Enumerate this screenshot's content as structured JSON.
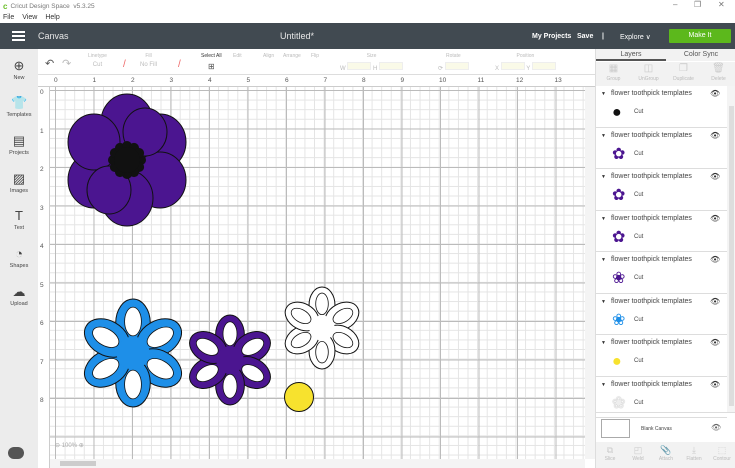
{
  "app": {
    "logo": "c",
    "title": "Cricut Design Space",
    "version": "v5.3.25"
  },
  "window": {
    "minimize": "–",
    "restore": "❐",
    "close": "✕"
  },
  "menu": [
    "File",
    "View",
    "Help"
  ],
  "header": {
    "section": "Canvas",
    "document": "Untitled*",
    "my_projects": "My Projects",
    "save": "Save",
    "separator": "|",
    "explore": "Explore ∨",
    "make_it": "Make It",
    "make_it_color": "#5cb81c"
  },
  "sidebar": [
    {
      "label": "New",
      "icon": "plus-circle-icon"
    },
    {
      "label": "Templates",
      "icon": "shirt-icon"
    },
    {
      "label": "Projects",
      "icon": "projects-icon"
    },
    {
      "label": "Images",
      "icon": "image-icon"
    },
    {
      "label": "Text",
      "icon": "text-icon"
    },
    {
      "label": "Shapes",
      "icon": "shapes-icon"
    },
    {
      "label": "Upload",
      "icon": "upload-icon"
    }
  ],
  "toolbar": {
    "linetype": "Linetype",
    "linetype_value": "Cut",
    "fill": "Fill",
    "fill_value": "No Fill",
    "select_all": "Select All",
    "edit": "Edit",
    "align": "Align",
    "arrange": "Arrange",
    "flip": "Flip",
    "size": "Size",
    "size_w": "W",
    "size_h": "H",
    "rotate": "Rotate",
    "position": "Position",
    "pos_x": "X",
    "pos_y": "Y"
  },
  "ruler": {
    "h": [
      "0",
      "1",
      "2",
      "3",
      "4",
      "5",
      "6",
      "7",
      "8",
      "9",
      "10",
      "11",
      "12",
      "13"
    ],
    "v": [
      "0",
      "1",
      "2",
      "3",
      "4",
      "5",
      "6",
      "7",
      "8"
    ]
  },
  "zoom": "100%",
  "panel": {
    "tabs": [
      "Layers",
      "Color Sync"
    ],
    "tools": [
      "Group",
      "UnGroup",
      "Duplicate",
      "Delete"
    ],
    "layers": [
      {
        "name": "flower toothpick templates",
        "op": "Cut",
        "color": "#111111"
      },
      {
        "name": "flower toothpick templates",
        "op": "Cut",
        "color": "#4b1590"
      },
      {
        "name": "flower toothpick templates",
        "op": "Cut",
        "color": "#4b1590"
      },
      {
        "name": "flower toothpick templates",
        "op": "Cut",
        "color": "#4b1590"
      },
      {
        "name": "flower toothpick templates",
        "op": "Cut",
        "color": "#4b1590"
      },
      {
        "name": "flower toothpick templates",
        "op": "Cut",
        "color": "#1e8fe8"
      },
      {
        "name": "flower toothpick templates",
        "op": "Cut",
        "color": "#f7e22e"
      },
      {
        "name": "flower toothpick templates",
        "op": "Cut",
        "color": "#eeeeee"
      }
    ],
    "blank_canvas": "Blank Canvas",
    "bottom_tools": [
      "Slice",
      "Weld",
      "Attach",
      "Flatten",
      "Contour"
    ]
  },
  "colors": {
    "purple": "#4b1590",
    "blue": "#1e8fe8",
    "yellow": "#f7e22e",
    "black": "#111111",
    "header": "#414a51"
  }
}
